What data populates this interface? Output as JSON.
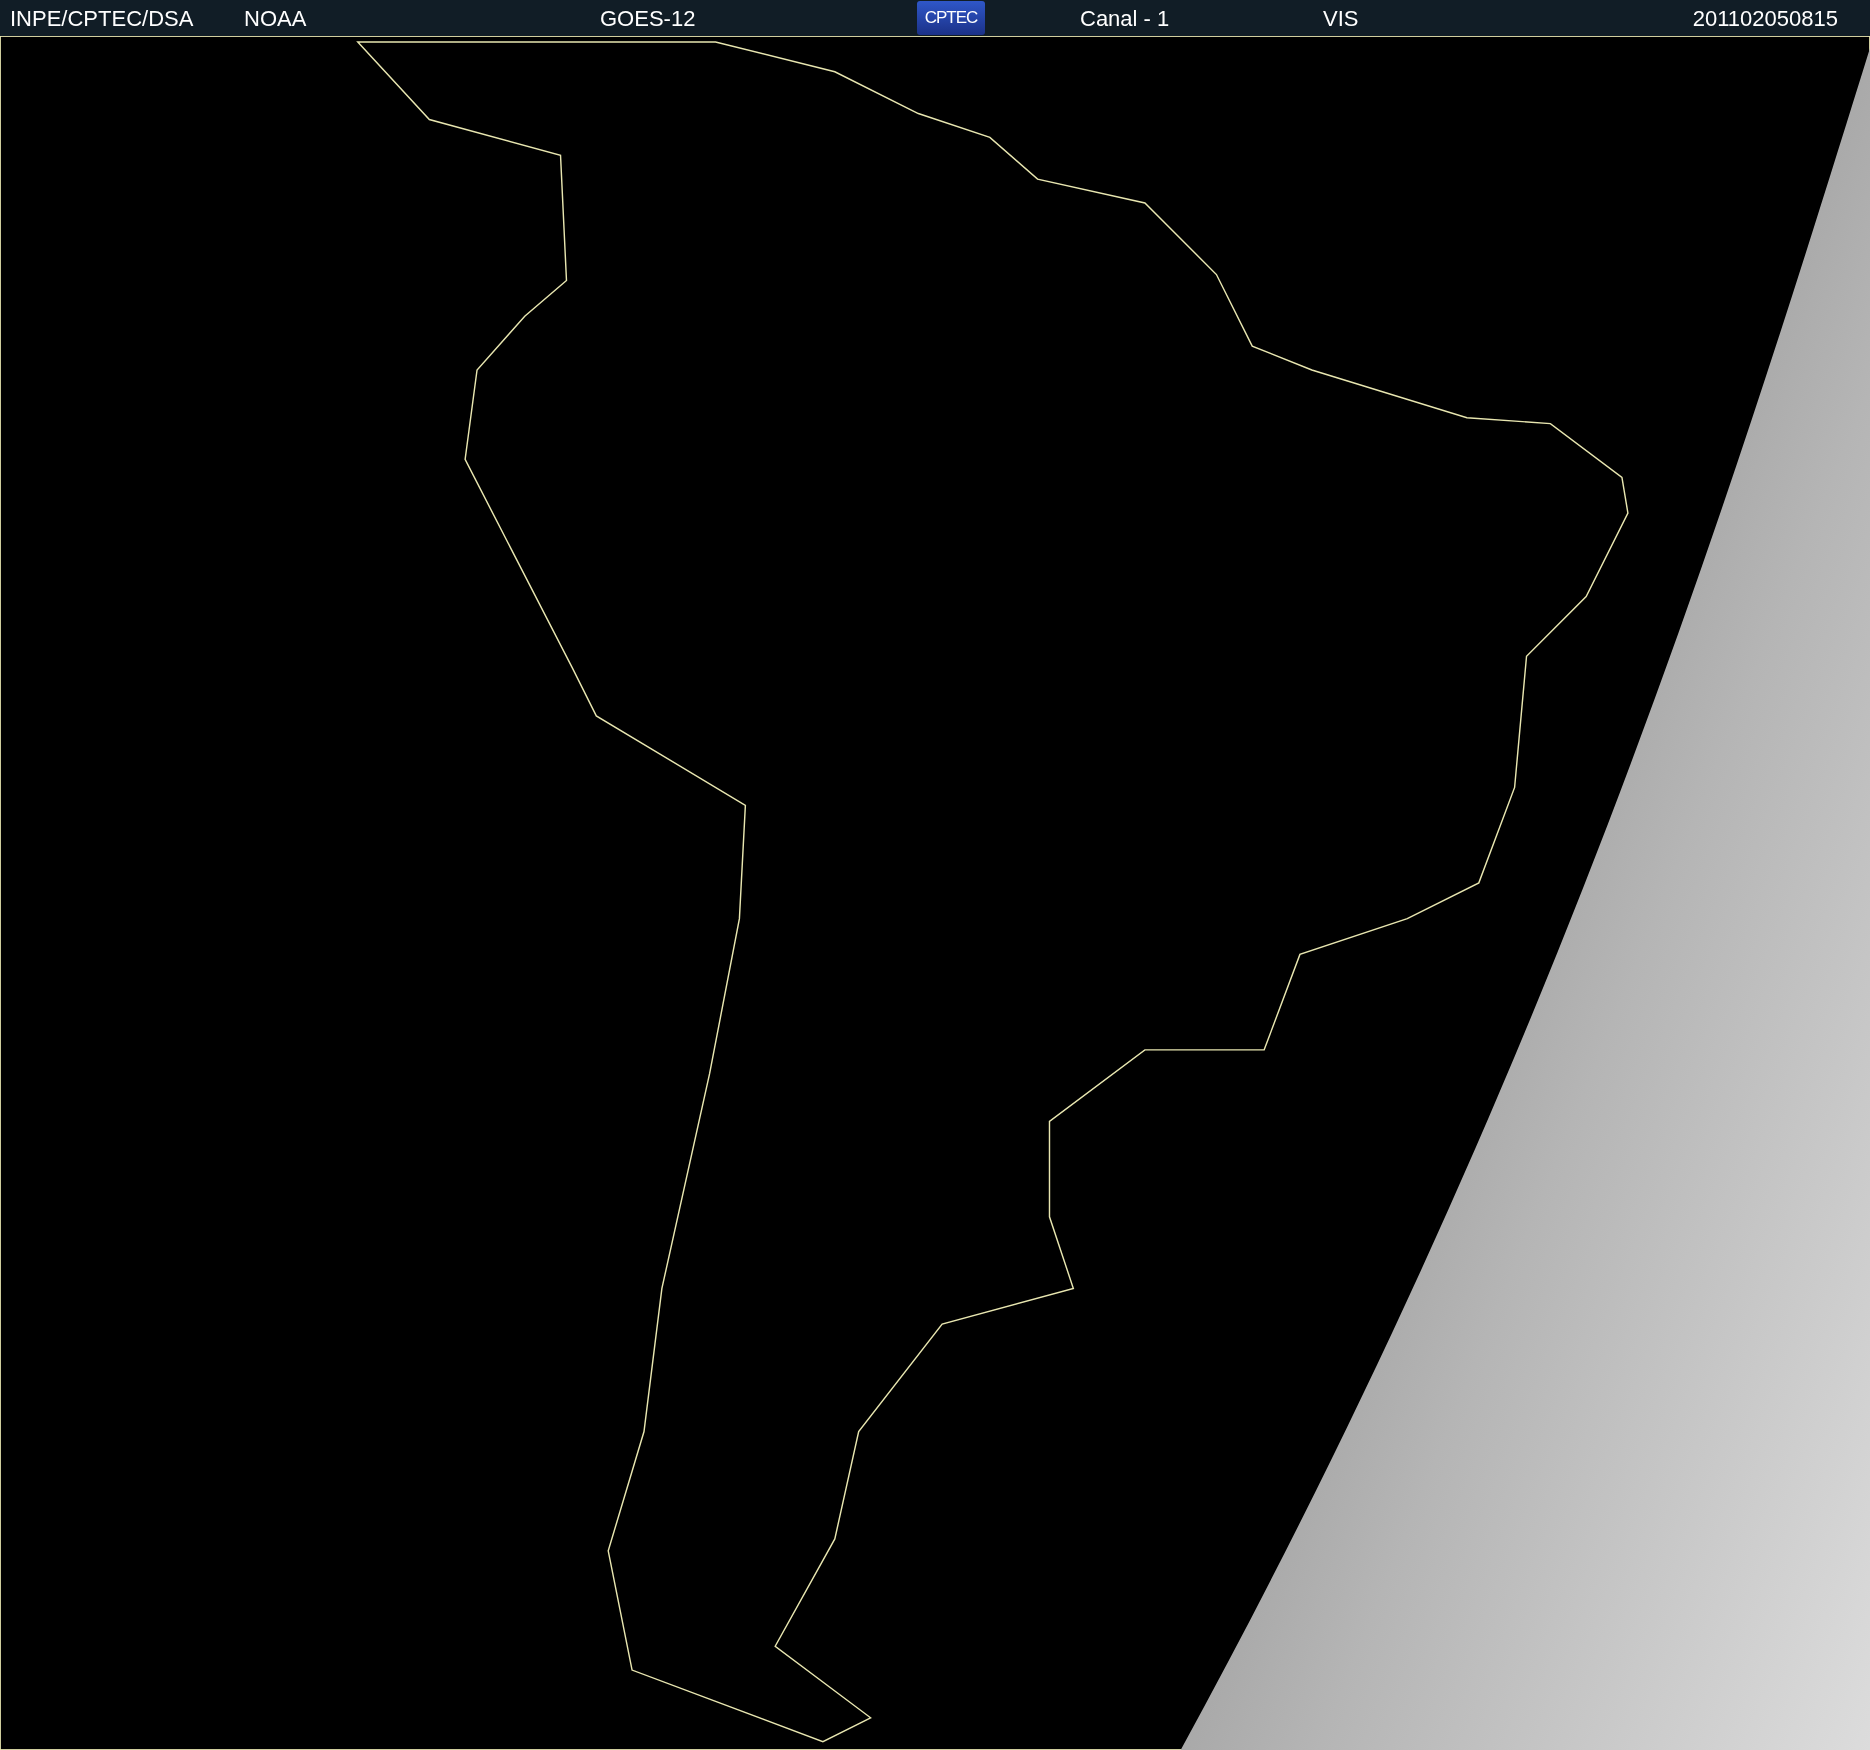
{
  "header": {
    "items": [
      {
        "kind": "text",
        "text": "INPE/CPTEC/DSA"
      },
      {
        "kind": "text",
        "text": "NOAA"
      },
      {
        "kind": "text",
        "text": "GOES-12"
      },
      {
        "kind": "logo",
        "text": "CPTEC"
      },
      {
        "kind": "text",
        "text": "Canal - 1"
      },
      {
        "kind": "text",
        "text": "VIS"
      },
      {
        "kind": "text",
        "text": "201102050815"
      }
    ]
  }
}
